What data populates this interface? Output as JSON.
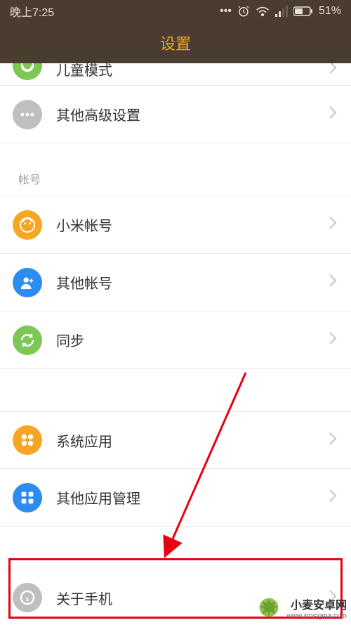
{
  "statusbar": {
    "time": "晚上7:25",
    "battery": "51%"
  },
  "header": {
    "title": "设置"
  },
  "rows": {
    "child_mode": {
      "label": "儿童模式"
    },
    "other_advanced": {
      "label": "其他高级设置"
    },
    "section_account": "帐号",
    "mi_account": {
      "label": "小米帐号"
    },
    "other_account": {
      "label": "其他帐号"
    },
    "sync": {
      "label": "同步"
    },
    "system_apps": {
      "label": "系统应用"
    },
    "other_apps": {
      "label": "其他应用管理"
    },
    "about_phone": {
      "label": "关于手机"
    }
  },
  "watermark": {
    "main": "小麦安卓网",
    "sub": "www.xmsigma.com"
  }
}
